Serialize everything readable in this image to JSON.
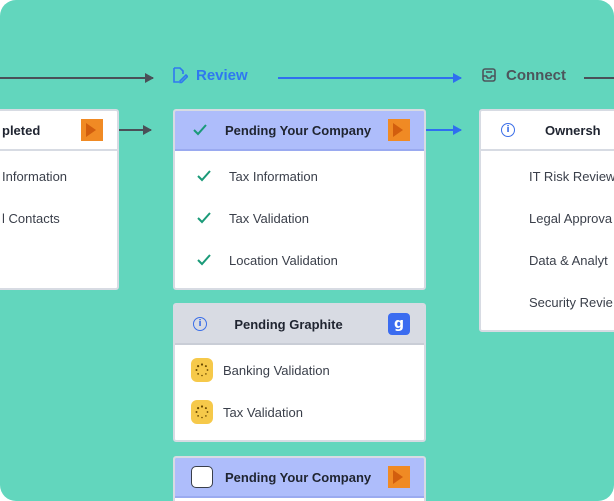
{
  "stages": {
    "review": {
      "label": "Review",
      "icon": "edit-document-icon",
      "color": "#2f78f0"
    },
    "connect": {
      "label": "Connect",
      "icon": "inbox-icon",
      "color": "#4d555c"
    }
  },
  "cards": {
    "completed": {
      "title": "pleted",
      "logo": "orange-brand-logo",
      "items": [
        "Information",
        "l Contacts"
      ]
    },
    "pending_company": {
      "title": "Pending Your Company",
      "status_icon": "checkmark-icon",
      "logo": "orange-brand-logo",
      "items": [
        "Tax Information",
        "Tax Validation",
        "Location Validation"
      ]
    },
    "pending_graphite": {
      "title": "Pending Graphite",
      "status_icon": "info-icon",
      "logo_text": "g",
      "items": [
        "Banking Validation",
        "Tax Validation"
      ]
    },
    "pending_company_2": {
      "title": "Pending Your Company",
      "logo": "orange-brand-logo"
    },
    "ownership": {
      "title": "Ownersh",
      "status_icon": "info-icon",
      "items": [
        "IT Risk Review",
        "Legal Approva",
        "Data & Analyt",
        "Security Revie"
      ]
    }
  },
  "colors": {
    "background": "#62d6bd",
    "accent_blue": "#2f78f0",
    "check_green": "#1a9a78",
    "header_blue": "#aebdfb",
    "header_grey": "#d8dbe3",
    "spinner_yellow": "#f6c94a",
    "logo_orange": "#f08a24"
  }
}
